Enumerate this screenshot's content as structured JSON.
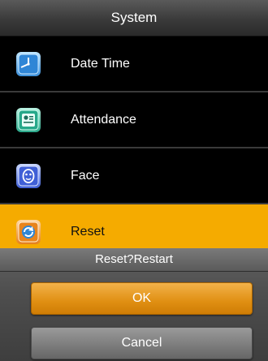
{
  "header": {
    "title": "System"
  },
  "menu": {
    "items": [
      {
        "label": "Date Time",
        "icon": "clock-icon"
      },
      {
        "label": "Attendance",
        "icon": "attendance-icon"
      },
      {
        "label": "Face",
        "icon": "face-icon"
      },
      {
        "label": "Reset",
        "icon": "reset-icon",
        "selected": true
      }
    ]
  },
  "dialog": {
    "title": "Reset?Restart",
    "ok_label": "OK",
    "cancel_label": "Cancel"
  },
  "colors": {
    "selected": "#f5ab00",
    "ok_button": "#e08f12",
    "cancel_button": "#7b7b7b"
  }
}
